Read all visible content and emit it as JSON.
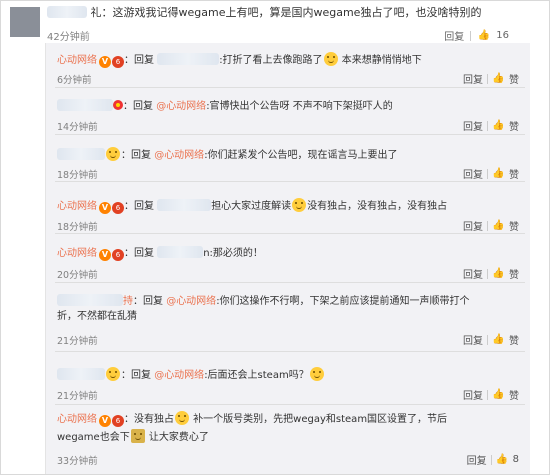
{
  "top_comment": {
    "text_part1": "礼：这游戏我记得wegame上有吧，算是国内wegame独占了吧，也没啥特别的",
    "time": "42分钟前",
    "reply_label": "回复",
    "like_count": "16"
  },
  "replies": [
    {
      "user": "心动网络",
      "l1": "：回复 ",
      "l1b": ":打折了看上去像跑路了",
      "l1c": " 本来想静悄悄地下",
      "l2": "",
      "time": "6分钟前",
      "reply": "回复",
      "like": "赞"
    },
    {
      "user": "",
      "l1": "：回复 ",
      "link": "@心动网络",
      "l1b": ":官博快出个公告呀 不声不响下架挺吓人的",
      "l2": "",
      "time": "14分钟前",
      "reply": "回复",
      "like": "赞"
    },
    {
      "user": "",
      "l1": "：回复 ",
      "link": "@心动网络",
      "l1b": ":你们赶紧发个公告吧，现在谣言马上要出了",
      "l2": "",
      "time": "18分钟前",
      "reply": "回复",
      "like": "赞"
    },
    {
      "user": "心动网络",
      "l1": "：回复 ",
      "l1b": "担心大家过度解读",
      "l1c": "没有独占，没有独占，没有独占",
      "l2": "",
      "time": "18分钟前",
      "reply": "回复",
      "like": "赞"
    },
    {
      "user": "心动网络",
      "l1": "：回复 ",
      "l1b": "n:那必须的！",
      "l2": "",
      "time": "20分钟前",
      "reply": "回复",
      "like": "赞"
    },
    {
      "user": "",
      "l0": "持",
      "l1": "：回复 ",
      "link": "@心动网络",
      "l1b": ":你们这操作不行啊，下架之前应该提前通知一声顺带打个",
      "l2": "折，不然都在乱猜",
      "time": "21分钟前",
      "reply": "回复",
      "like": "赞"
    },
    {
      "user": "",
      "l1": "：回复 ",
      "link": "@心动网络",
      "l1b": ":后面还会上steam吗？",
      "l2": "",
      "time": "21分钟前",
      "reply": "回复",
      "like": "赞"
    },
    {
      "user": "心动网络",
      "l1": "：没有独占",
      "l1b": " 补一个版号类别，先把wegay和steam国区设置了，节后",
      "l2": "wegame也会下",
      "l2b": " 让大家费心了",
      "time": "33分钟前",
      "reply": "回复",
      "like": "8"
    }
  ],
  "colors": {
    "accent": "#eb7350",
    "panel": "#f2f2f5",
    "time": "#808080"
  },
  "icons": [
    "vip-badge-icon",
    "level-badge-icon",
    "emoji-icon",
    "like-icon"
  ]
}
